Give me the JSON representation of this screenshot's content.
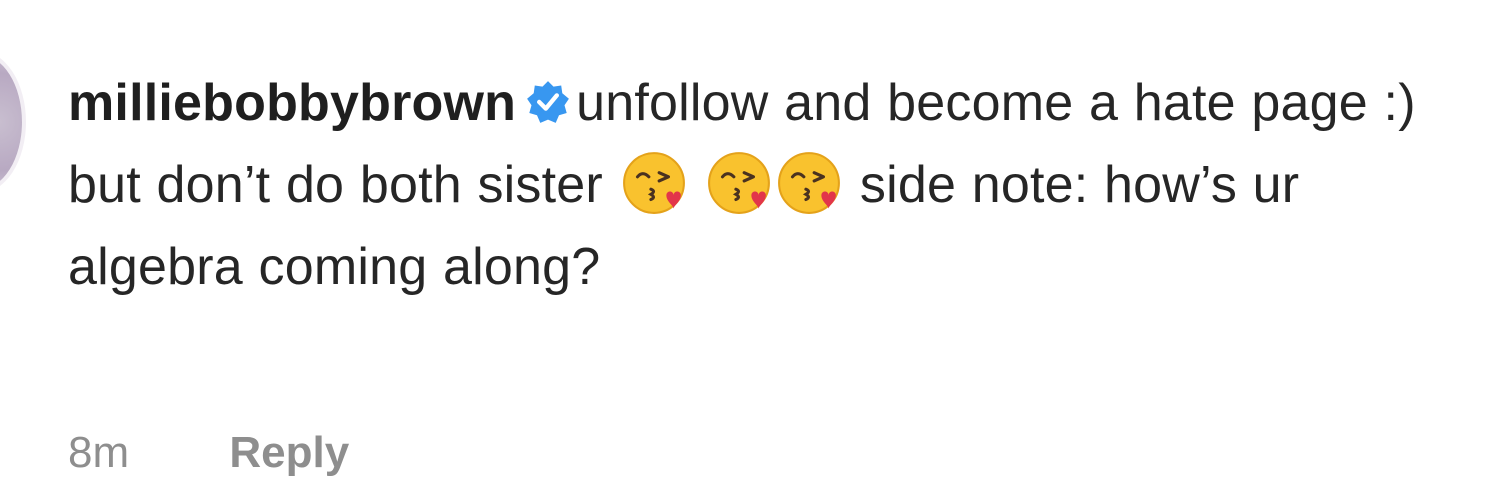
{
  "comment": {
    "username": "milliebobbybrown",
    "verified_icon": "verified-badge-icon",
    "text_part1": "unfollow and become a hate page :) but don’t do both sister",
    "emoji_name": "face-blowing-a-kiss",
    "text_part2": "side note: how’s ur algebra coming along?",
    "timestamp": "8m",
    "reply_label": "Reply"
  },
  "colors": {
    "text": "#262626",
    "meta": "#8e8e8e",
    "verified": "#3897f0"
  }
}
